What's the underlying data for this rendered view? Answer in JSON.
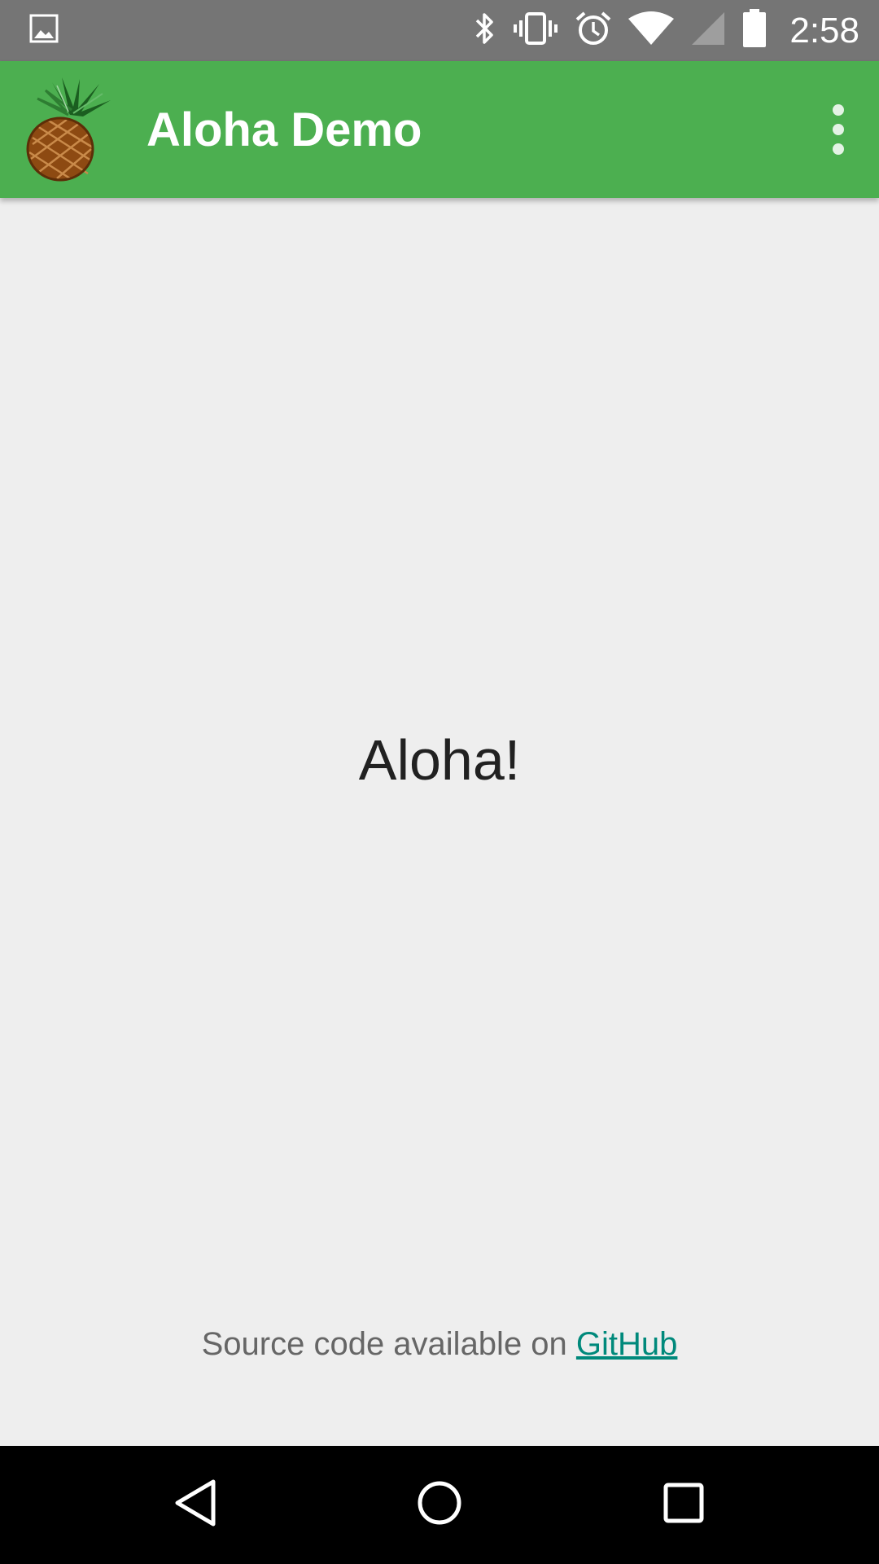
{
  "status_bar": {
    "time": "2:58",
    "icons": [
      "image-notification-icon",
      "bluetooth-icon",
      "vibrate-icon",
      "alarm-icon",
      "wifi-icon",
      "cell-signal-icon",
      "battery-icon"
    ]
  },
  "app_bar": {
    "title": "Aloha Demo",
    "logo": "pineapple-logo",
    "menu_icon": "overflow-menu-icon"
  },
  "main": {
    "greeting": "Aloha!",
    "footer_prefix": "Source code available on ",
    "footer_link": "GitHub"
  },
  "nav_bar": {
    "buttons": [
      "back-icon",
      "home-icon",
      "recents-icon"
    ]
  },
  "colors": {
    "status_bar": "#757575",
    "app_bar": "#4caf50",
    "background": "#eeeeee",
    "link": "#00897b",
    "nav_bar": "#000000"
  }
}
